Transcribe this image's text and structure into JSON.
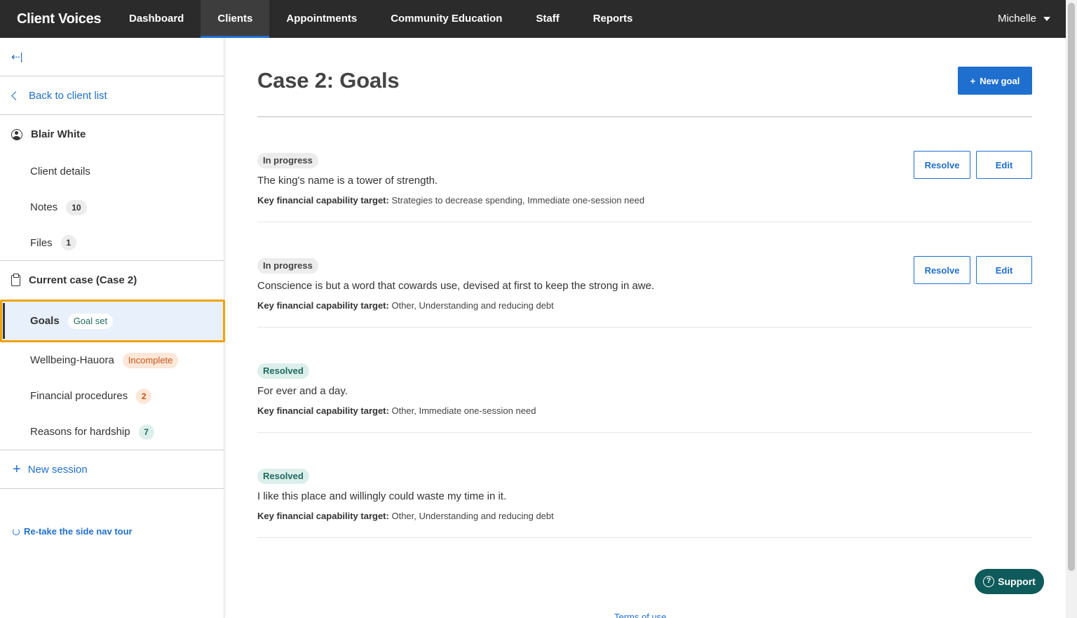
{
  "app": {
    "title": "Client Voices"
  },
  "topnav": {
    "items": [
      {
        "label": "Dashboard"
      },
      {
        "label": "Clients"
      },
      {
        "label": "Appointments"
      },
      {
        "label": "Community Education"
      },
      {
        "label": "Staff"
      },
      {
        "label": "Reports"
      }
    ],
    "active": "Clients",
    "user": "Michelle"
  },
  "sidebar": {
    "collapse_glyph": "⇠|",
    "back_label": "Back to client list",
    "client_name": "Blair White",
    "client_items": [
      {
        "label": "Client details"
      },
      {
        "label": "Notes",
        "count": "10"
      },
      {
        "label": "Files",
        "count": "1"
      }
    ],
    "case_label": "Current case (Case 2)",
    "case_items": {
      "goals": {
        "label": "Goals",
        "badge": "Goal set"
      },
      "wellbeing": {
        "label": "Wellbeing-Hauora",
        "badge": "Incomplete"
      },
      "financial": {
        "label": "Financial procedures",
        "count": "2"
      },
      "hardship": {
        "label": "Reasons for hardship",
        "count": "7"
      }
    },
    "new_session": "New session",
    "retake_tour": "Re-take the side nav tour"
  },
  "main": {
    "title": "Case 2: Goals",
    "new_goal_label": "New goal",
    "resolve_label": "Resolve",
    "edit_label": "Edit",
    "target_label": "Key financial capability target:",
    "goals": [
      {
        "status": "In progress",
        "text": "The king's name is a tower of strength.",
        "target": "Strategies to decrease spending, Immediate one-session need"
      },
      {
        "status": "In progress",
        "text": "Conscience is but a word that cowards use, devised at first to keep the strong in awe.",
        "target": "Other, Understanding and reducing debt"
      },
      {
        "status": "Resolved",
        "text": "For ever and a day.",
        "target": "Other, Immediate one-session need"
      },
      {
        "status": "Resolved",
        "text": "I like this place and willingly could waste my time in it.",
        "target": "Other, Understanding and reducing debt"
      }
    ]
  },
  "support_label": "Support",
  "footer_link": "Terms of use",
  "colors": {
    "accent": "#1f6fcf",
    "nav_bg": "#2b2b2b",
    "highlight": "#f0a30a",
    "support_bg": "#0f5a5a"
  }
}
